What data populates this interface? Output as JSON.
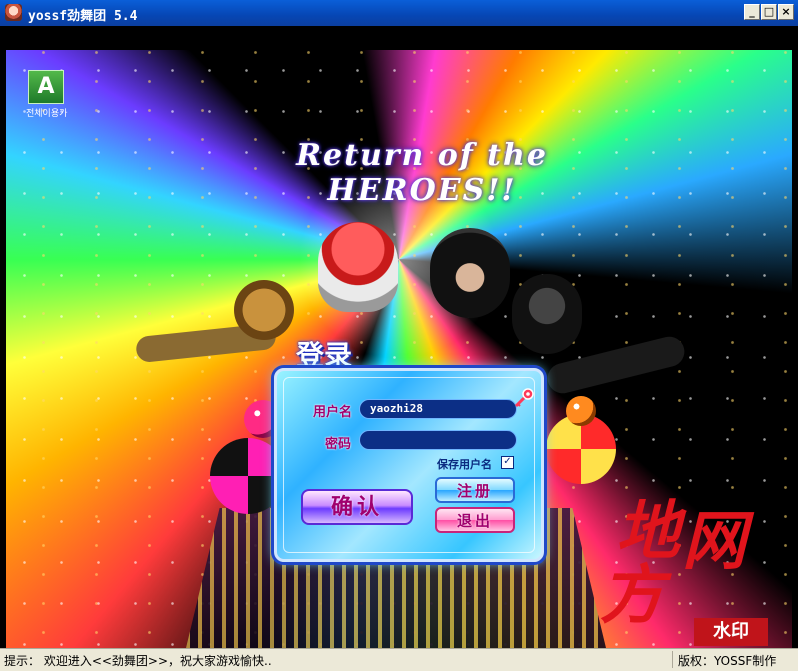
{
  "window": {
    "title": "yossf劲舞团 5.4",
    "buttons": {
      "minimize": "_",
      "maximize": "□",
      "close": "×"
    }
  },
  "scene": {
    "logo_caption": "전체이용가",
    "logo_mark": "A",
    "game_title": "Return of the HEROES!!"
  },
  "login": {
    "heading": "登录",
    "username_label": "用户名",
    "username_value": "yaozhi28",
    "password_label": "密码",
    "password_value": "",
    "remember_label": "保存用户名",
    "remember_checked_glyph": "✓",
    "confirm_button": "确认",
    "register_button": "注册",
    "exit_button": "退出"
  },
  "watermark": {
    "char1": "地",
    "char2": "网",
    "char3": "方",
    "stamp": "水印"
  },
  "statusbar": {
    "tip": "提示： 欢迎进入<<劲舞团>>，祝大家游戏愉快..",
    "copyright": "版权：YOSSF制作"
  },
  "colors": {
    "titlebar": "#0646b4",
    "panel_accent": "#2fb2ff",
    "label_text": "#a0006e"
  }
}
